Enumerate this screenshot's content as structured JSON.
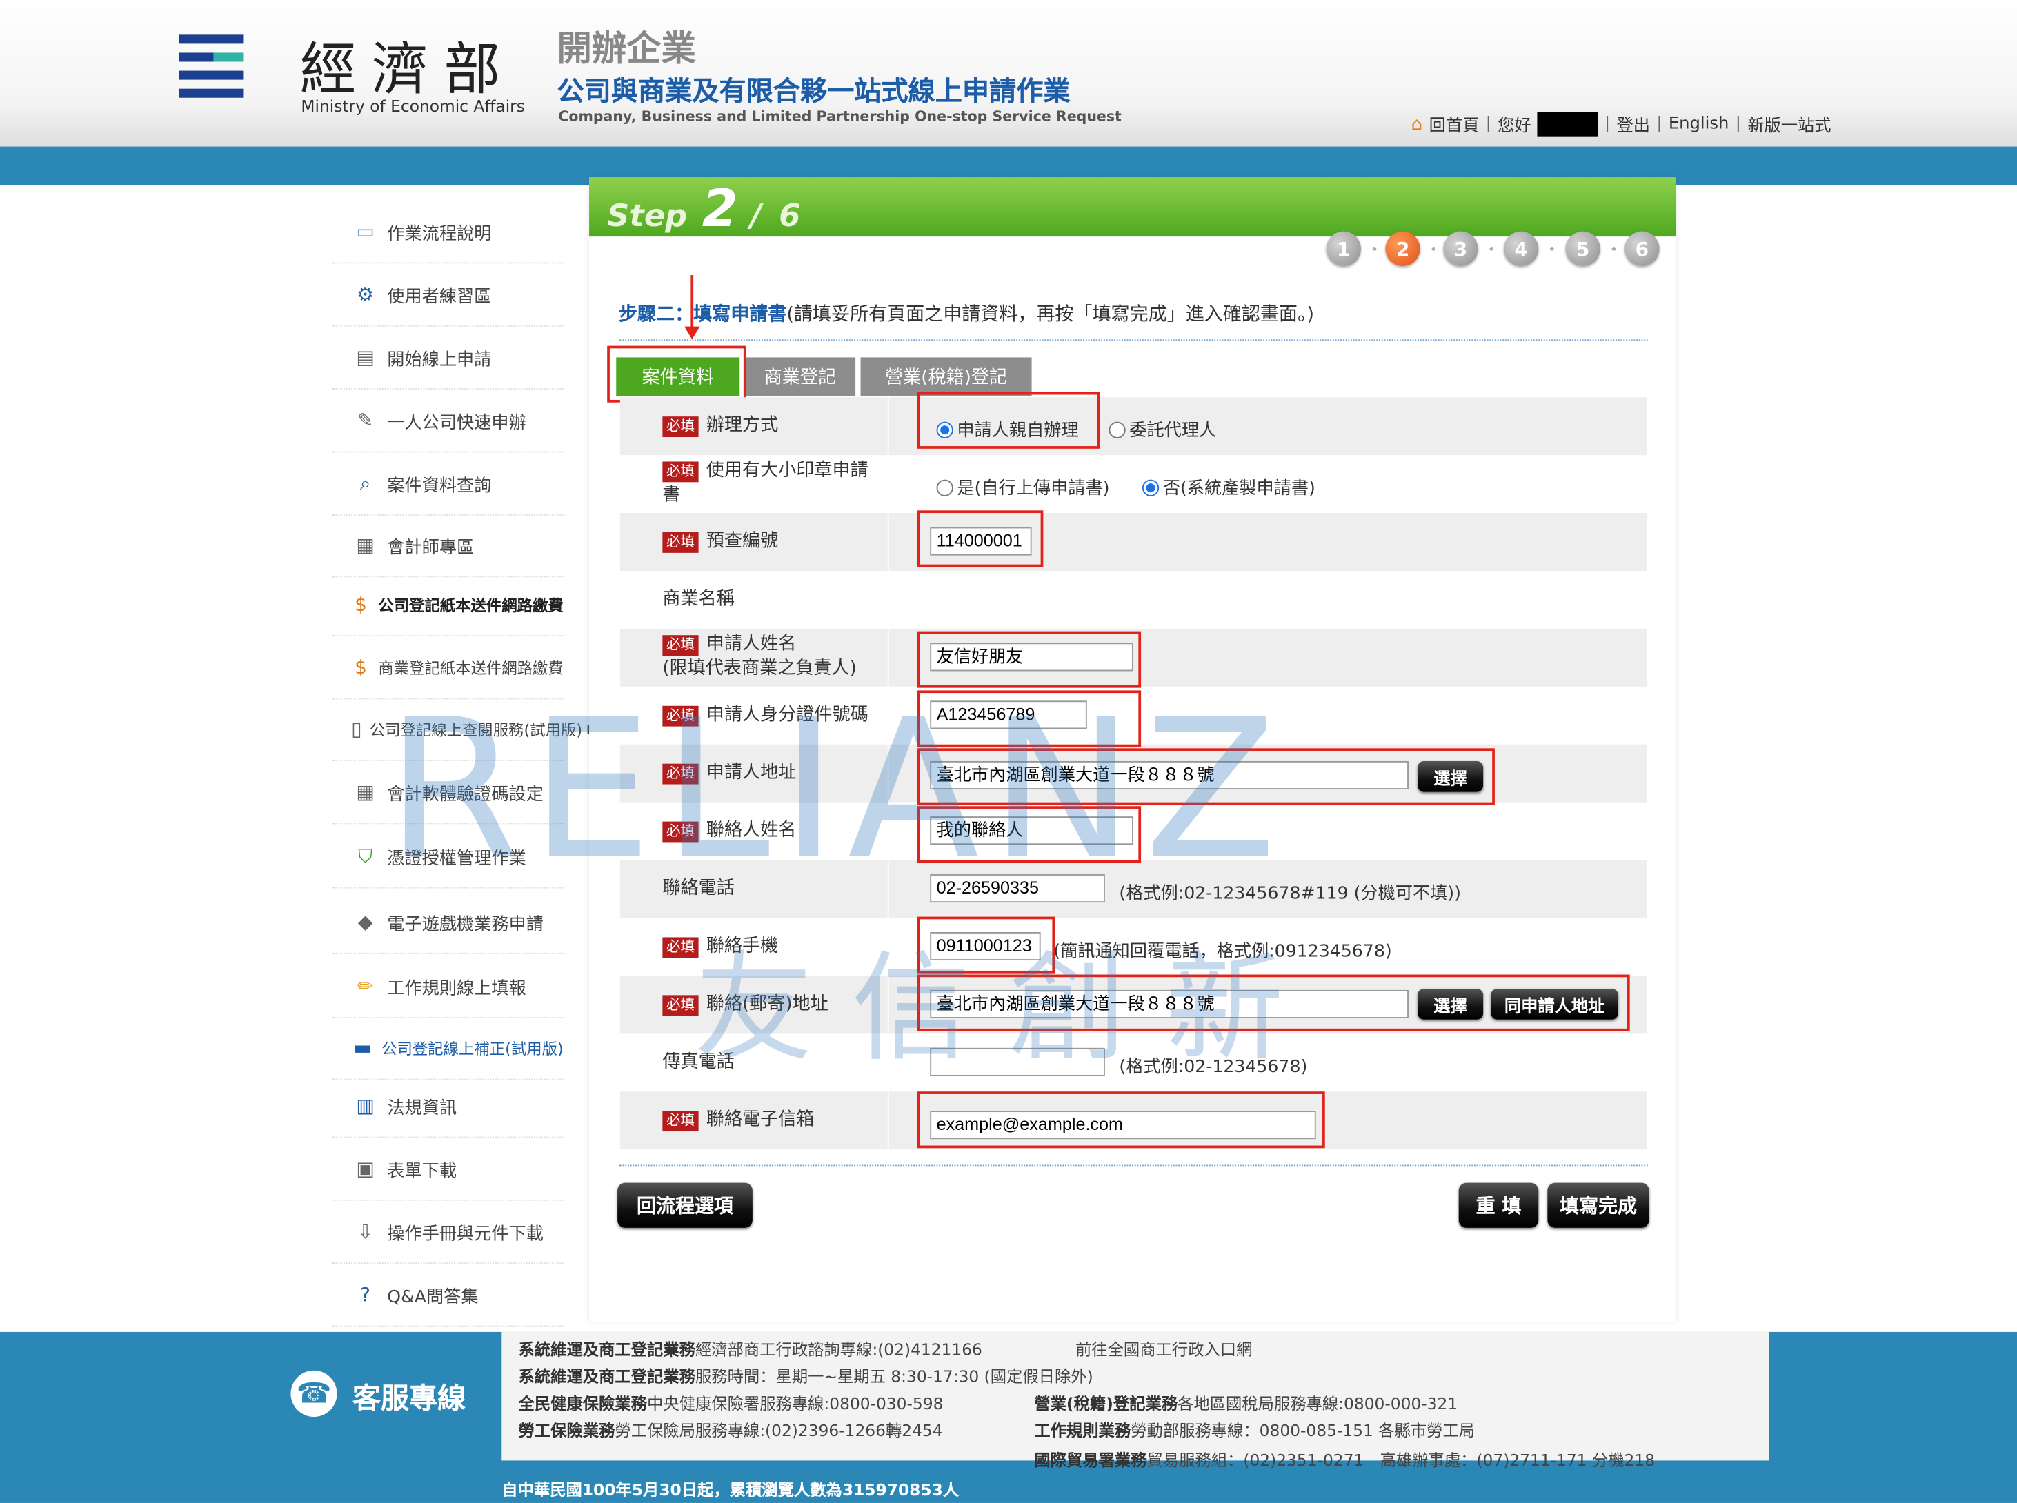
{
  "header": {
    "ministry_zh": "經濟部",
    "ministry_en": "Ministry of Economic Affairs",
    "system_short": "開辦企業",
    "system_title": "公司與商業及有限合夥一站式線上申請作業",
    "system_en": "Company, Business and Limited Partnership One-stop Service Request",
    "links": {
      "home": "回首頁",
      "hello": "您好",
      "logout": "登出",
      "english": "English",
      "new_version": "新版一站式"
    }
  },
  "sidebar": {
    "items": [
      {
        "label": "作業流程說明",
        "icon": "chat-bubble-icon"
      },
      {
        "label": "使用者練習區",
        "icon": "gears-icon"
      },
      {
        "label": "開始線上申請",
        "icon": "document-icon"
      },
      {
        "label": "一人公司快速申辦",
        "icon": "edit-form-icon"
      },
      {
        "label": "案件資料查詢",
        "icon": "magnifier-icon"
      },
      {
        "label": "會計師專區",
        "icon": "calculator-icon"
      },
      {
        "label": "公司登記紙本送件網路繳費",
        "icon": "coin-payment-icon"
      },
      {
        "label": "商業登記紙本送件網路繳費",
        "icon": "coin-payment-icon"
      },
      {
        "label": "公司登記線上查閱服務(試用版)",
        "icon": "document-view-icon"
      },
      {
        "label": "會計軟體驗證碼設定",
        "icon": "spreadsheet-icon"
      },
      {
        "label": "憑證授權管理作業",
        "icon": "shield-icon"
      },
      {
        "label": "電子遊戲機業務申請",
        "icon": "gamepad-icon"
      },
      {
        "label": "工作規則線上填報",
        "icon": "pencil-icon"
      },
      {
        "label": "公司登記線上補正(試用版)",
        "icon": "web-icon"
      },
      {
        "label": "法規資訊",
        "icon": "book-icon"
      },
      {
        "label": "表單下載",
        "icon": "save-icon"
      },
      {
        "label": "操作手冊與元件下載",
        "icon": "download-icon"
      },
      {
        "label": "Q&A問答集",
        "icon": "question-icon"
      }
    ]
  },
  "step": {
    "prefix": "Step",
    "current": "2",
    "sep": "/",
    "total": "6",
    "dots": [
      "1",
      "2",
      "3",
      "4",
      "5",
      "6"
    ]
  },
  "heading": {
    "title": "步驟二：填寫申請書",
    "desc": "(請填妥所有頁面之申請資料，再按「填寫完成」進入確認畫面。)"
  },
  "tabs": [
    "案件資料",
    "商業登記",
    "營業(稅籍)登記"
  ],
  "required_badge": "必填",
  "form": {
    "method": {
      "label": "辦理方式",
      "opt1": "申請人親自辦理",
      "opt2": "委託代理人"
    },
    "seal": {
      "label1": "使用有大小印章申請",
      "label2": "書",
      "opt1": "是(自行上傳申請書)",
      "opt2": "否(系統產製申請書)"
    },
    "precheck": {
      "label": "預查編號",
      "value": "114000001"
    },
    "biz_name": {
      "label": "商業名稱"
    },
    "applicant_name": {
      "label1": "申請人姓名",
      "label2": "(限填代表商業之負責人)",
      "value": "友信好朋友"
    },
    "applicant_id": {
      "label": "申請人身分證件號碼",
      "value": "A123456789"
    },
    "applicant_addr": {
      "label": "申請人地址",
      "value": "臺北市內湖區創業大道一段８８８號",
      "button": "選擇"
    },
    "contact_name": {
      "label": "聯絡人姓名",
      "value": "我的聯絡人"
    },
    "contact_phone": {
      "label": "聯絡電話",
      "value": "02-26590335",
      "hint": "(格式例:02-12345678#119 (分機可不填))"
    },
    "contact_mobile": {
      "label": "聯絡手機",
      "value": "0911000123",
      "hint": "(簡訊通知回覆電話，格式例:0912345678)"
    },
    "mail_addr": {
      "label": "聯絡(郵寄)地址",
      "value": "臺北市內湖區創業大道一段８８８號",
      "button": "選擇",
      "button2": "同申請人地址"
    },
    "fax": {
      "label": "傳真電話",
      "value": "",
      "hint": "(格式例:02-12345678)"
    },
    "email": {
      "label": "聯絡電子信箱",
      "value": "example@example.com"
    }
  },
  "buttons": {
    "back": "回流程選項",
    "reset": "重 填",
    "done": "填寫完成"
  },
  "watermark": {
    "text1": "RELIANZ",
    "text2": "友信創新"
  },
  "footer": {
    "cs_label": "客服專線",
    "lines": [
      {
        "bold": "系統維運及商工登記業務",
        "text": "經濟部商工行政諮詢專線:(02)4121166"
      },
      {
        "bold": "系統維運及商工登記業務",
        "text": "服務時間：星期一~星期五 8:30-17:30 (國定假日除外)"
      },
      {
        "bold": "全民健康保險業務",
        "text": "中央健康保險署服務專線:0800-030-598"
      },
      {
        "bold": "勞工保險業務",
        "text": "勞工保險局服務專線:(02)2396-1266轉2454"
      }
    ],
    "right_lines": [
      {
        "bold": "",
        "text": "前往全國商工行政入口網"
      },
      {
        "bold": "營業(稅籍)登記業務",
        "text": "各地區國稅局服務專線:0800-000-321"
      },
      {
        "bold": "工作規則業務",
        "text": "勞動部服務專線：0800-085-151 各縣市勞工局"
      },
      {
        "bold": "國際貿易署業務",
        "text": "貿易服務組：(02)2351-0271　高雄辦事處：(07)2711-171 分機218"
      }
    ],
    "visit": "自中華民國100年5月30日起，累積瀏覽人數為315970853人"
  },
  "colors": {
    "brand_blue": "#2b87b6",
    "step_green": "#4ea81f",
    "active_step": "#e0501a",
    "required_red": "#b51d1d",
    "highlight_red": "#e2231a"
  }
}
